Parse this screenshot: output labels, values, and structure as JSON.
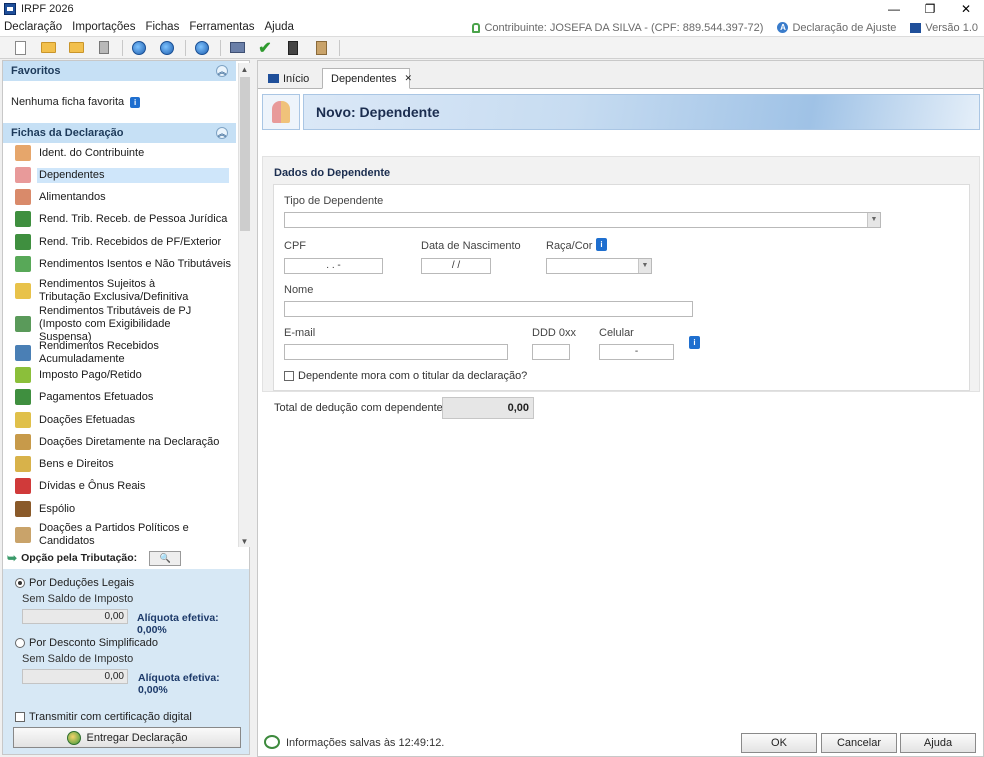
{
  "window": {
    "title": "IRPF 2026"
  },
  "menu": {
    "items": [
      "Declaração",
      "Importações",
      "Fichas",
      "Ferramentas",
      "Ajuda"
    ],
    "contribuinte": "Contribuinte: JOSEFA DA SILVA - (CPF: 889.544.397-72)",
    "declaracao": "Declaração de Ajuste",
    "versao": "Versão 1.0"
  },
  "sidebar": {
    "favoritos_title": "Favoritos",
    "favoritos_empty": "Nenhuma ficha favorita",
    "fichas_title": "Fichas da Declaração",
    "fichas": [
      {
        "label": "Ident. do Contribuinte",
        "color": "#e6a66b"
      },
      {
        "label": "Dependentes",
        "color": "#e89a9a",
        "selected": true
      },
      {
        "label": "Alimentandos",
        "color": "#d98a6a"
      },
      {
        "label": "Rend. Trib. Receb. de Pessoa Jurídica",
        "color": "#3f8f3f"
      },
      {
        "label": "Rend. Trib. Recebidos de PF/Exterior",
        "color": "#3f8f3f"
      },
      {
        "label": "Rendimentos Isentos e Não Tributáveis",
        "color": "#58a858"
      },
      {
        "label": "Rendimentos Sujeitos à Tributação Exclusiva/Definitiva",
        "color": "#e8c24a"
      },
      {
        "label": "Rendimentos Tributáveis de PJ (Imposto com Exigibilidade Suspensa)",
        "color": "#5a9a5a"
      },
      {
        "label": "Rendimentos Recebidos Acumuladamente",
        "color": "#4a7fb5"
      },
      {
        "label": "Imposto Pago/Retido",
        "color": "#8bbf3a"
      },
      {
        "label": "Pagamentos Efetuados",
        "color": "#3f8f3f"
      },
      {
        "label": "Doações Efetuadas",
        "color": "#e0c04a"
      },
      {
        "label": "Doações Diretamente na Declaração",
        "color": "#c79a4a"
      },
      {
        "label": "Bens e Direitos",
        "color": "#d8b24a"
      },
      {
        "label": "Dívidas e Ônus Reais",
        "color": "#d03a3a"
      },
      {
        "label": "Espólio",
        "color": "#8a5a2a"
      },
      {
        "label": "Doações a Partidos Políticos e Candidatos",
        "color": "#c9a36a"
      }
    ],
    "tributacao_title": "Opção pela Tributação:",
    "deducoes": {
      "label": "Por Deduções Legais",
      "sub": "Sem Saldo de Imposto",
      "value": "0,00",
      "aliquota": "Alíquota efetiva: 0,00%"
    },
    "simplificado": {
      "label": "Por Desconto Simplificado",
      "sub": "Sem Saldo de Imposto",
      "value": "0,00",
      "aliquota": "Alíquota efetiva: 0,00%"
    },
    "transmitir": "Transmitir com certificação digital",
    "entregar": "Entregar Declaração"
  },
  "tabs": {
    "home": "Início",
    "current": "Dependentes"
  },
  "form": {
    "heading": "Novo: Dependente",
    "section": "Dados do Dependente",
    "tipo_label": "Tipo de Dependente",
    "cpf_label": "CPF",
    "cpf_value": ".   .   -",
    "nascimento_label": "Data de Nascimento",
    "nascimento_value": "/  /",
    "raca_label": "Raça/Cor",
    "nome_label": "Nome",
    "email_label": "E-mail",
    "ddd_label": "DDD 0xx",
    "celular_label": "Celular",
    "celular_value": "-",
    "mora_label": "Dependente mora com o titular da declaração?",
    "total_label": "Total de dedução com dependentes:",
    "total_value": "0,00"
  },
  "status": {
    "text": "Informações salvas às 12:49:12."
  },
  "buttons": {
    "ok": "OK",
    "cancel": "Cancelar",
    "help": "Ajuda"
  }
}
